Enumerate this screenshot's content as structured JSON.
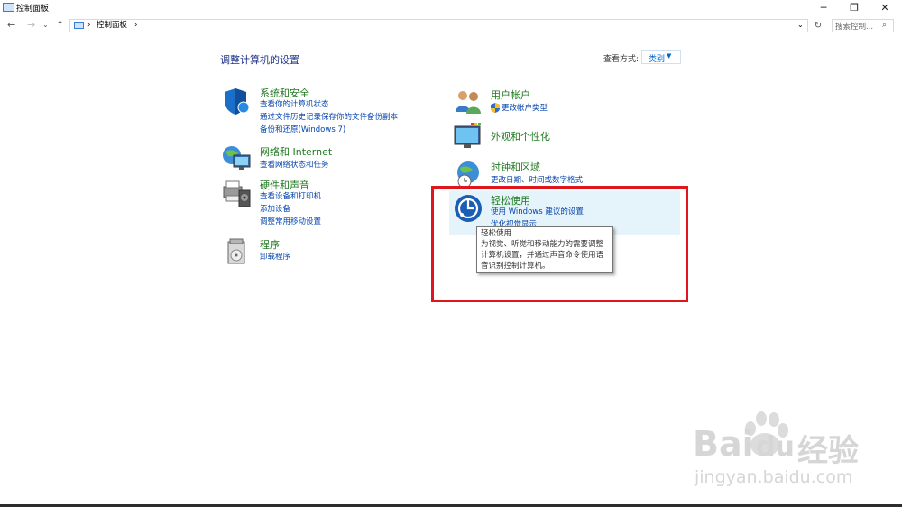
{
  "window": {
    "title": "控制面板",
    "minimize": "─",
    "maximize": "❐",
    "close": "✕"
  },
  "address": {
    "back": "←",
    "forward": "→",
    "history": "⌄",
    "up": "↑",
    "separator1": "›",
    "breadcrumb": "控制面板",
    "separator2": "›",
    "history2": "⌄",
    "refresh": "↻",
    "search_placeholder": "搜索控制...",
    "search_icon": "⌕"
  },
  "main": {
    "heading": "调整计算机的设置",
    "view_by_label": "查看方式:",
    "view_by_value": "类别",
    "view_by_arrow": "▼"
  },
  "categories": {
    "system": {
      "title": "系统和安全",
      "links": [
        "查看你的计算机状态",
        "通过文件历史记录保存你的文件备份副本",
        "备份和还原(Windows 7)"
      ]
    },
    "network": {
      "title": "网络和 Internet",
      "links": [
        "查看网络状态和任务"
      ]
    },
    "hardware": {
      "title": "硬件和声音",
      "links": [
        "查看设备和打印机",
        "添加设备",
        "调整常用移动设置"
      ]
    },
    "programs": {
      "title": "程序",
      "links": [
        "卸载程序"
      ]
    },
    "user": {
      "title": "用户帐户",
      "links": [
        "更改帐户类型"
      ]
    },
    "appearance": {
      "title": "外观和个性化",
      "links": []
    },
    "clock": {
      "title": "时钟和区域",
      "links": [
        "更改日期、时间或数字格式"
      ]
    },
    "ease": {
      "title": "轻松使用",
      "links": [
        "使用 Windows 建议的设置",
        "优化视觉显示"
      ]
    }
  },
  "tooltip": {
    "lines": [
      "轻松使用",
      "为视觉、听觉和移动能力的需要调整",
      "计算机设置，并通过声音命令使用语",
      "音识别控制计算机。"
    ]
  },
  "watermark": {
    "brand": "Bai",
    "brand2": "du",
    "product": "经验",
    "url": "jingyan.baidu.com"
  },
  "colors": {
    "category_title": "#217a21",
    "link": "#0645ad",
    "heading": "#1e3287",
    "highlight": "#e5f3fb",
    "annotation_red": "#e0161f"
  }
}
